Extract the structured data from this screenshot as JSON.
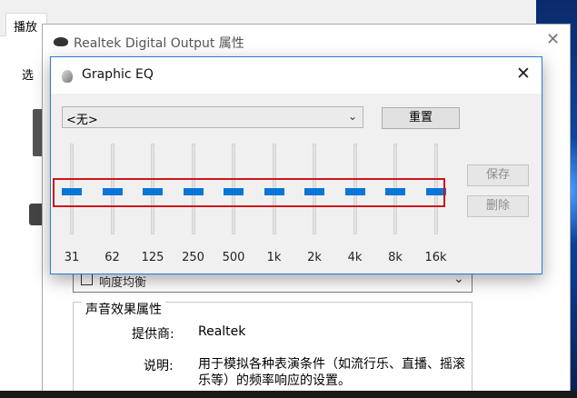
{
  "background_window": {
    "tab_label": "播放",
    "side_label": "选"
  },
  "realtek_window": {
    "title": "Realtek Digital Output 属性",
    "close_glyph": "✕",
    "select_partial_text": "响度均衡",
    "select_arrow": "⌄",
    "group_title": "声音效果属性",
    "provider_label": "提供商:",
    "provider_value": "Realtek",
    "description_label": "说明:",
    "description_value": "用于模拟各种表演条件（如流行乐、直播、摇滚乐等）的频率响应的设置。"
  },
  "eq_dialog": {
    "title": "Graphic EQ",
    "close_glyph": "✕",
    "preset_value": "<无>",
    "preset_arrow": "⌄",
    "reset_label": "重置",
    "save_label": "保存",
    "delete_label": "删除",
    "bands": [
      {
        "label": "31",
        "level": 0
      },
      {
        "label": "62",
        "level": 0
      },
      {
        "label": "125",
        "level": 0
      },
      {
        "label": "250",
        "level": 0
      },
      {
        "label": "500",
        "level": 0
      },
      {
        "label": "1k",
        "level": 0
      },
      {
        "label": "2k",
        "level": 0
      },
      {
        "label": "4k",
        "level": 0
      },
      {
        "label": "8k",
        "level": 0
      },
      {
        "label": "16k",
        "level": 0
      }
    ]
  },
  "colors": {
    "accent": "#0a75d6",
    "highlight_border": "#d0121b",
    "dialog_border": "#2b78d6"
  }
}
